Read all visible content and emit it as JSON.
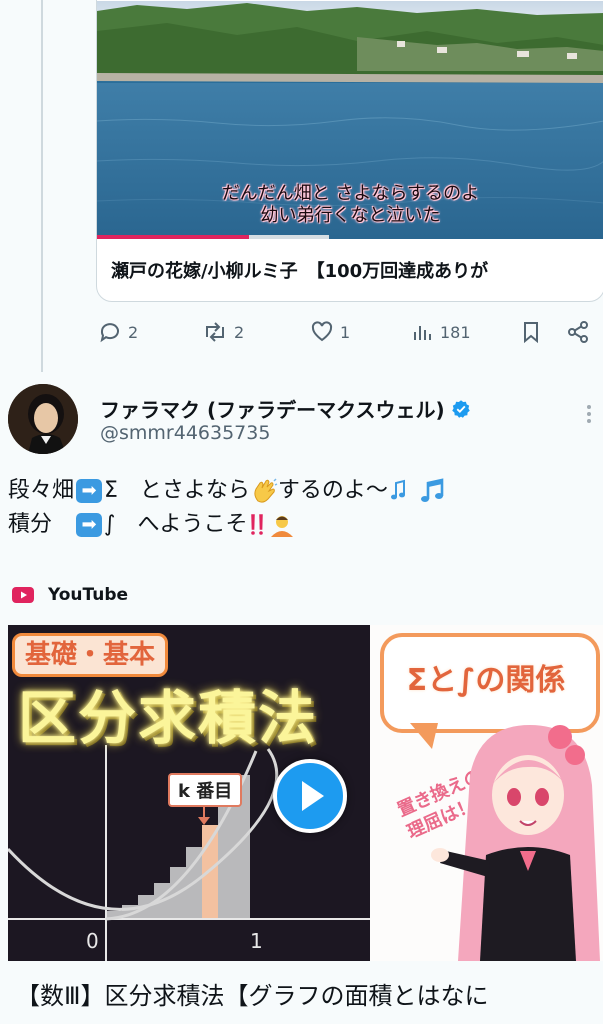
{
  "previous_tweet": {
    "video_caption_line1": "だんだん畑と さよならするのよ",
    "video_caption_line2": "幼い弟行くなと泣いた",
    "video_progress_fraction": 0.3,
    "card_title": "瀬戸の花嫁/小柳ルミ子　【100万回達成ありが",
    "actions": {
      "reply_count": "2",
      "retweet_count": "2",
      "like_count": "1",
      "views_count": "181"
    }
  },
  "tweet": {
    "display_name": "ファラマク (ファラデーマクスウェル)",
    "handle": "@smmr44635735",
    "text_line1_a": "段々畑",
    "text_line1_b": "Σ　とさよなら",
    "text_line1_c": "するのよ〜",
    "text_line2_a": "積分　",
    "text_line2_b": "∫　へようこそ",
    "verified_color": "#1d9bf0"
  },
  "embed": {
    "source_label": "YouTube",
    "thumbnail": {
      "badge": "基礎・基本",
      "title": "区分求積法",
      "k_label": "k 番目",
      "axis_zero": "0",
      "axis_one": "1",
      "speech_bubble": "Σと∫の関係",
      "side_text_line1": "置き換えの",
      "side_text_line2": "理屈は！？"
    },
    "video_title": "【数Ⅲ】区分求積法【グラフの面積とはなに"
  }
}
